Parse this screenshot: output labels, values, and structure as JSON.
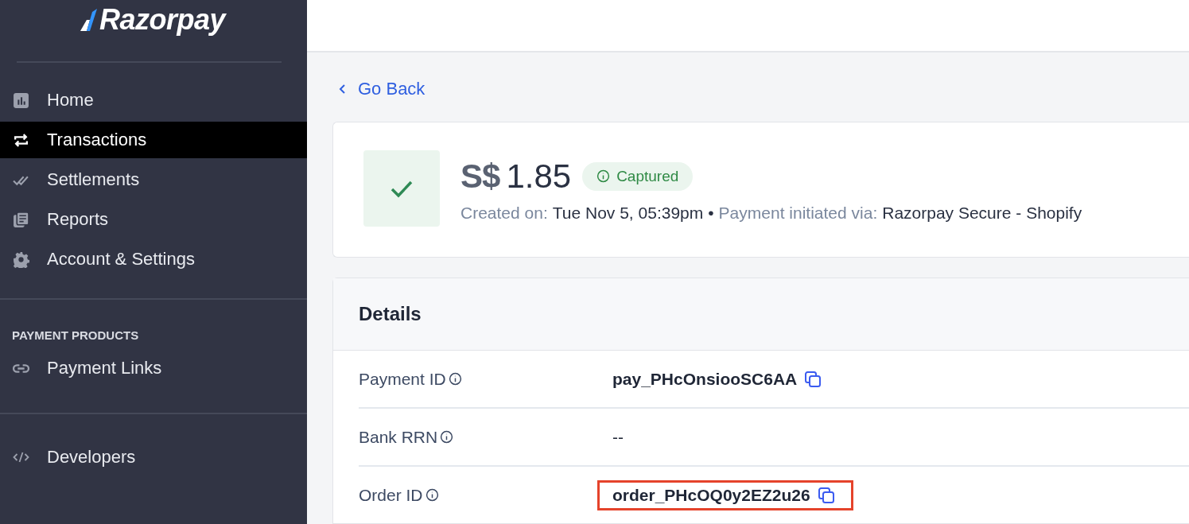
{
  "sidebar": {
    "logo": "Razorpay",
    "items": [
      {
        "label": "Home",
        "kind": "chart",
        "selected": false
      },
      {
        "label": "Transactions",
        "kind": "swap",
        "selected": true
      },
      {
        "label": "Settlements",
        "kind": "checks",
        "selected": false
      },
      {
        "label": "Reports",
        "kind": "docs",
        "selected": false
      },
      {
        "label": "Account & Settings",
        "kind": "gear",
        "selected": false
      }
    ],
    "section_title": "PAYMENT PRODUCTS",
    "product_items": [
      {
        "label": "Payment Links",
        "kind": "link",
        "selected": false
      }
    ],
    "bottom_items": [
      {
        "label": "Developers",
        "kind": "code",
        "selected": false
      }
    ]
  },
  "back_link": "Go Back",
  "payment": {
    "currency": "S$",
    "amount": "1.85",
    "status": "Captured",
    "meta": [
      {
        "label": "Created on:",
        "value": "Tue Nov 5, 05:39pm"
      },
      {
        "label": "Payment initiated via:",
        "value": "Razorpay Secure - Shopify"
      }
    ],
    "separator": "•"
  },
  "details": {
    "title": "Details",
    "rows": [
      {
        "label": "Payment ID",
        "value": "pay_PHcOnsiooSC6AA",
        "copyable": true,
        "highlighted": false
      },
      {
        "label": "Bank RRN",
        "value": "--",
        "copyable": false,
        "highlighted": false
      },
      {
        "label": "Order ID",
        "value": "order_PHcOQ0y2EZ2u26",
        "copyable": true,
        "highlighted": true
      }
    ]
  }
}
